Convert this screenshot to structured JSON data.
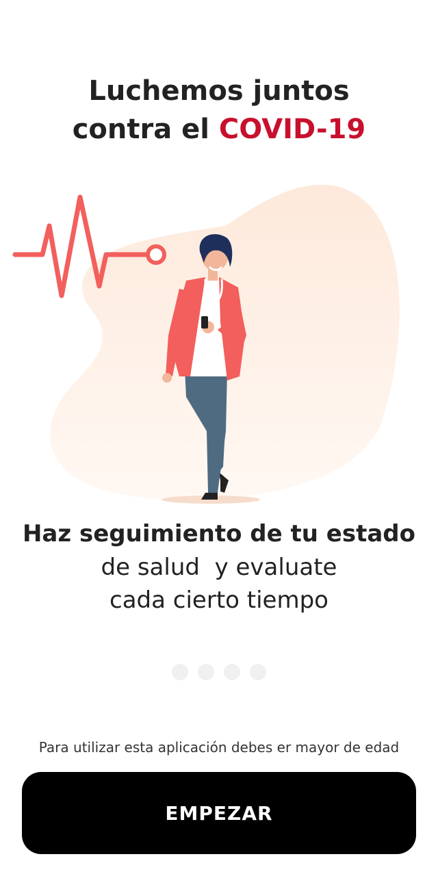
{
  "header": {
    "title_line1": "Luchemos juntos",
    "title_line2_prefix": "contra el ",
    "title_line2_accent": "COVID-19"
  },
  "onboarding": {
    "headline": "Haz seguimiento de tu estado",
    "line2": "de salud  y evaluate",
    "line3": "cada cierto tiempo",
    "pages": 4
  },
  "footer": {
    "notice": "Para utilizar esta aplicación debes er mayor de edad",
    "cta_label": "EMPEZAR"
  },
  "colors": {
    "accent": "#c8102e",
    "heartbeat": "#f25f5c",
    "button": "#000000",
    "blob": "#fdeee2"
  }
}
